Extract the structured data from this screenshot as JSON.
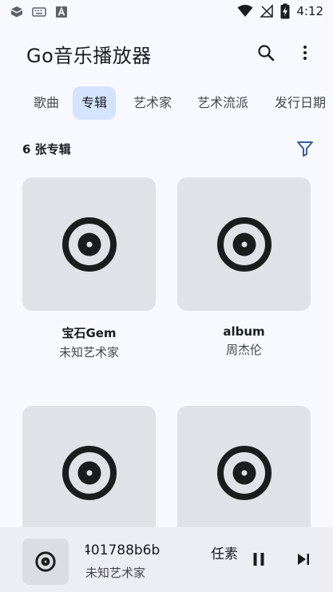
{
  "status_bar": {
    "time": "4:12",
    "left_icons": [
      "app-notification-icon",
      "keyboard-icon",
      "a-icon"
    ],
    "right_icons": [
      "wifi-icon",
      "no-signal-icon",
      "battery-charging-icon"
    ]
  },
  "app_bar": {
    "title": "Go音乐播放器",
    "search_icon": "search-icon",
    "more_icon": "more-vert-icon"
  },
  "tabs": [
    {
      "label": "歌曲",
      "active": false
    },
    {
      "label": "专辑",
      "active": true
    },
    {
      "label": "艺术家",
      "active": false
    },
    {
      "label": "艺术流派",
      "active": false
    },
    {
      "label": "发行日期",
      "active": false
    }
  ],
  "list_header": {
    "count_label": "6 张专辑",
    "filter_icon": "filter-icon"
  },
  "albums": [
    {
      "title": "宝石Gem",
      "artist": "未知艺术家",
      "icon": "vinyl-icon"
    },
    {
      "title": "album",
      "artist": "周杰伦",
      "icon": "vinyl-icon"
    },
    {
      "title": "",
      "artist": "",
      "icon": "vinyl-icon"
    },
    {
      "title": "",
      "artist": "",
      "icon": "vinyl-icon"
    }
  ],
  "player": {
    "title_part_a": "401788b6b",
    "title_part_b": "任素",
    "artist": "未知艺术家",
    "pause_icon": "pause-icon",
    "next_icon": "skip-next-icon"
  },
  "colors": {
    "background": "#f8f9ff",
    "active_tab": "#d6e3ff",
    "album_art_bg": "#e1e2e8",
    "player_bg": "#eceef4",
    "filter_icon": "#3a5f94",
    "text_primary": "#1a1c1e",
    "text_secondary": "#44474e"
  }
}
